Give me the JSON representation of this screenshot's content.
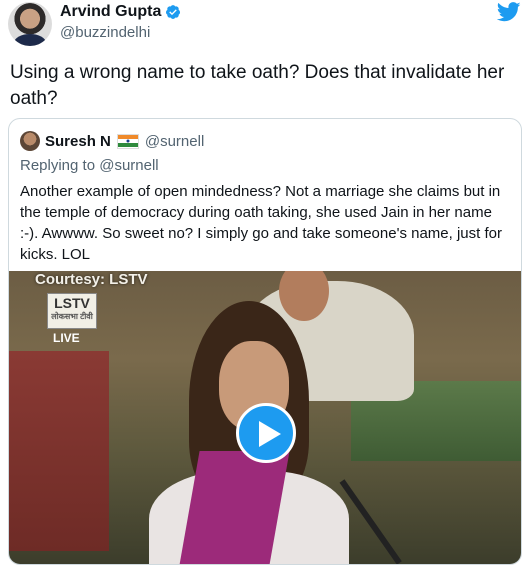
{
  "author": {
    "display_name": "Arvind Gupta",
    "handle": "@buzzindelhi",
    "verified_icon": "verified-badge-icon"
  },
  "brand_icon": "twitter-bird-icon",
  "tweet": {
    "text": "Using a wrong name to take oath? Does that invalidate her oath?"
  },
  "quoted_tweet": {
    "display_name": "Suresh N",
    "flag_icon": "india-flag-icon",
    "handle": "@surnell",
    "replying_prefix": "Replying to",
    "replying_to": "@surnell",
    "text": "Another example of open mindedness? Not a marriage she claims but in the temple of democracy during oath taking, she used Jain in her name :-). Awwww.  So sweet no? I simply go and take someone's name, just for kicks. LOL",
    "video": {
      "courtesy_text": "Courtesy: LSTV",
      "logo_text": "LSTV",
      "logo_subtext": "लोकसभा टीवी",
      "live_text": "LIVE",
      "play_icon": "play-icon"
    }
  },
  "colors": {
    "accent": "#1d9bf0",
    "secondary_text": "#536471",
    "border": "#cfd9de"
  }
}
